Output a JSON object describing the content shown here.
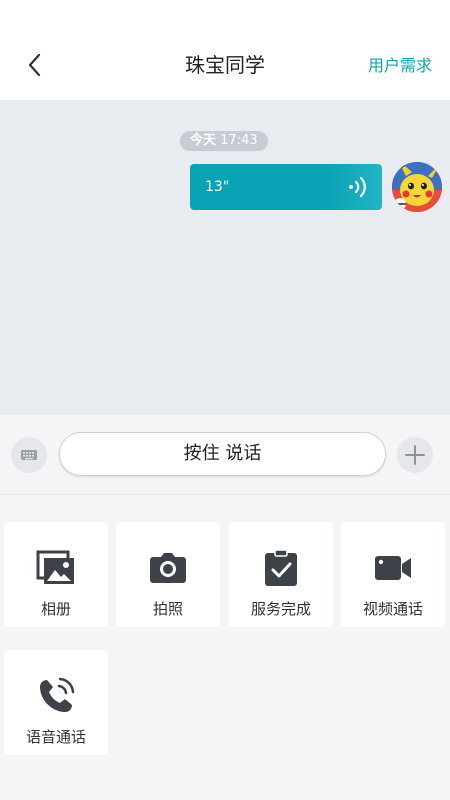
{
  "header": {
    "title": "珠宝同学",
    "right_action": "用户需求"
  },
  "chat": {
    "time_prefix": "今天",
    "time_value": "17:43",
    "messages": [
      {
        "type": "voice",
        "duration": "13\"",
        "sender": "self"
      }
    ]
  },
  "input_bar": {
    "talk_label": "按住 说话"
  },
  "actions": [
    {
      "label": "相册",
      "icon": "album-icon"
    },
    {
      "label": "拍照",
      "icon": "camera-icon"
    },
    {
      "label": "服务完成",
      "icon": "service-complete-icon"
    },
    {
      "label": "视频通话",
      "icon": "video-call-icon"
    },
    {
      "label": "语音通话",
      "icon": "voice-call-icon"
    }
  ],
  "colors": {
    "accent": "#15a0ad",
    "bubble": "#0aa2b5",
    "chat_bg": "#e8ecf1",
    "icon": "#3d4148"
  }
}
